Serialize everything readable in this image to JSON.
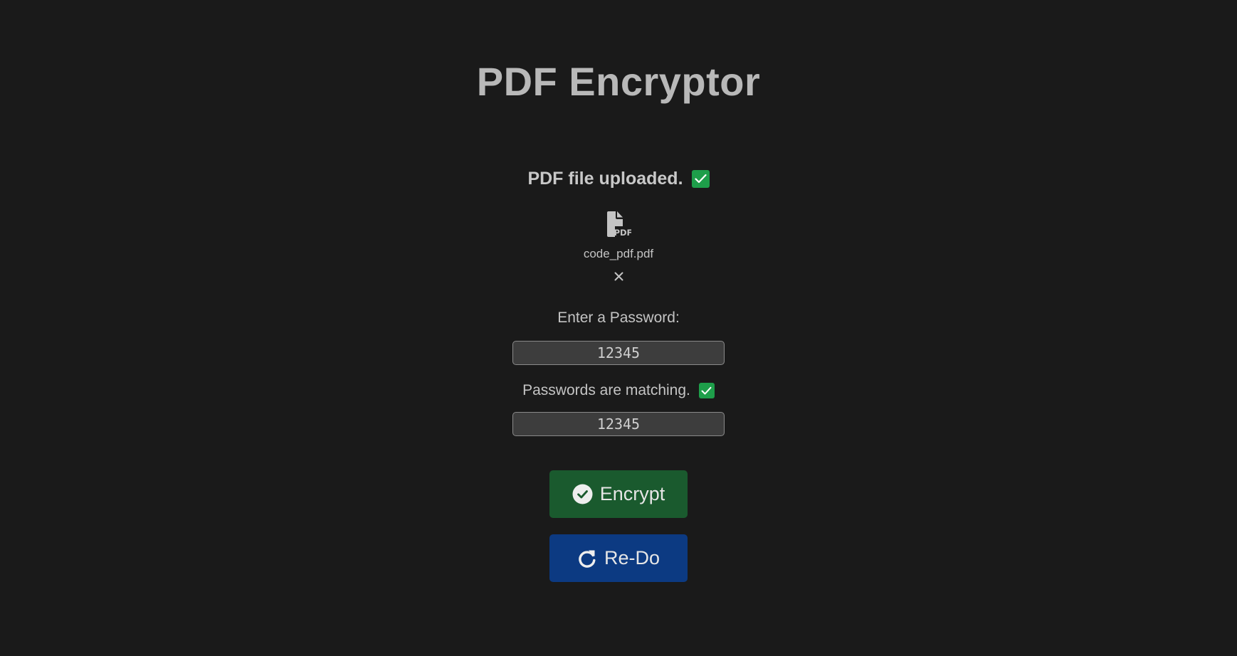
{
  "app": {
    "title": "PDF Encryptor"
  },
  "upload": {
    "status_text": "PDF file uploaded.",
    "status_icon": "checkbox-checked-icon",
    "status_color": "#1e9e4a"
  },
  "file": {
    "icon": "pdf-file-icon",
    "name": "code_pdf.pdf",
    "remove_icon": "close-icon",
    "remove_glyph": "×"
  },
  "password": {
    "label": "Enter a Password:",
    "value": "12345",
    "match_text": "Passwords are matching.",
    "confirm_value": "12345"
  },
  "buttons": {
    "encrypt_label": "Encrypt",
    "encrypt_icon": "check-circle-icon",
    "encrypt_color": "#1a5a2e",
    "redo_label": "Re-Do",
    "redo_icon": "redo-icon",
    "redo_color": "#0c3a82"
  }
}
